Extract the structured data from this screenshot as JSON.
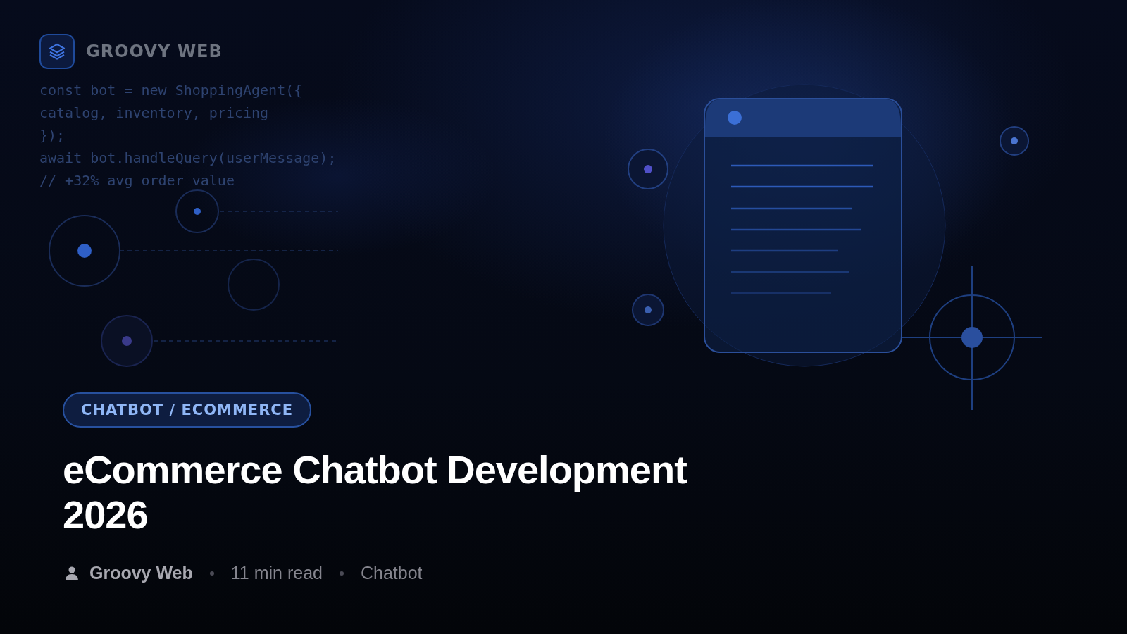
{
  "brand": {
    "name": "GROOVY WEB"
  },
  "code_lines": [
    "const bot = new ShoppingAgent({",
    "catalog, inventory, pricing",
    "});",
    "await bot.handleQuery(userMessage);",
    "// +32% avg order value"
  ],
  "tag": "CHATBOT / ECOMMERCE",
  "title": "eCommerce Chatbot Development 2026",
  "meta": [
    {
      "kind": "author",
      "text": "Groovy Web"
    },
    {
      "kind": "info",
      "text": "11 min read"
    },
    {
      "kind": "info",
      "text": "Chatbot"
    }
  ]
}
